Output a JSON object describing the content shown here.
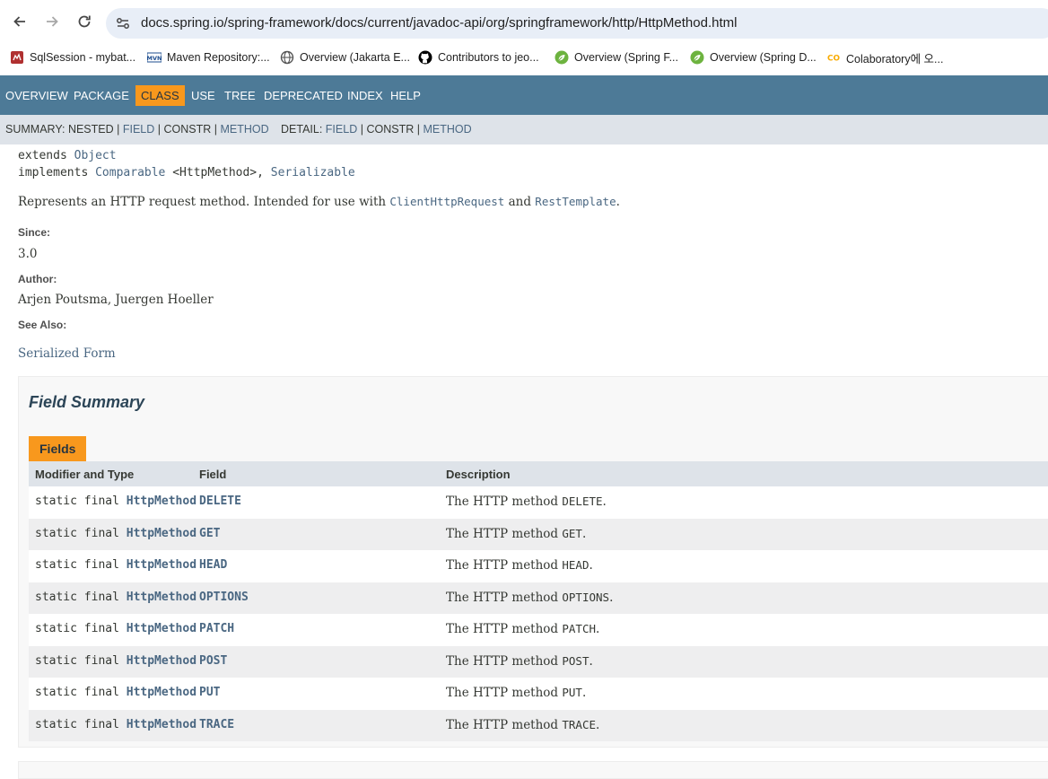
{
  "browser": {
    "url": "docs.spring.io/spring-framework/docs/current/javadoc-api/org/springframework/http/HttpMethod.html",
    "bookmarks": [
      {
        "label": "SqlSession - mybat...",
        "icon": "mybatis-icon",
        "color": "#b03030"
      },
      {
        "label": "Maven Repository:...",
        "icon": "mvn-icon",
        "color": "#1d4d8f",
        "text": "MVN"
      },
      {
        "label": "Overview (Jakarta E...",
        "icon": "globe-icon",
        "color": "#555555"
      },
      {
        "label": "Contributors to jeo...",
        "icon": "github-icon",
        "color": "#000000"
      },
      {
        "label": "Overview (Spring F...",
        "icon": "spring-leaf-icon",
        "color": "#6db33f"
      },
      {
        "label": "Overview (Spring D...",
        "icon": "spring-leaf-icon",
        "color": "#6db33f"
      },
      {
        "label": "Colaboratory에 오...",
        "icon": "colab-icon",
        "color": "#f9ab00",
        "text": "CO"
      }
    ]
  },
  "topnav": {
    "items": [
      "OVERVIEW",
      "PACKAGE",
      "CLASS",
      "USE",
      "TREE",
      "DEPRECATED",
      "INDEX",
      "HELP"
    ],
    "active": "CLASS",
    "active_color": "#f8981d",
    "bar_color": "#4d7a97"
  },
  "subnav": {
    "summary_label": "SUMMARY:",
    "summary_items": [
      "NESTED",
      "FIELD",
      "CONSTR",
      "METHOD"
    ],
    "detail_label": "DETAIL:",
    "detail_items": [
      "FIELD",
      "CONSTR",
      "METHOD"
    ],
    "sep": "|"
  },
  "classinfo": {
    "extends_kw": "extends",
    "extends_type": "Object",
    "implements_kw": "implements",
    "implements_type1": "Comparable",
    "implements_generic": "<HttpMethod>,",
    "implements_type2": "Serializable",
    "desc_pre": "Represents an HTTP request method. Intended for use with",
    "desc_link1": "ClientHttpRequest",
    "desc_mid": "and",
    "desc_link2": "RestTemplate",
    "desc_end": ".",
    "since_label": "Since:",
    "since_value": "3.0",
    "author_label": "Author:",
    "author_value": "Arjen Poutsma, Juergen Hoeller",
    "seealso_label": "See Also:",
    "seealso_value": "Serialized Form"
  },
  "field_summary": {
    "title": "Field Summary",
    "caption": "Fields",
    "headers": [
      "Modifier and Type",
      "Field",
      "Description"
    ],
    "rows": [
      {
        "mod": "static final",
        "type": "HttpMethod",
        "field": "DELETE",
        "desc_pre": "The HTTP method",
        "desc_code": "DELETE",
        "desc_end": "."
      },
      {
        "mod": "static final",
        "type": "HttpMethod",
        "field": "GET",
        "desc_pre": "The HTTP method",
        "desc_code": "GET",
        "desc_end": "."
      },
      {
        "mod": "static final",
        "type": "HttpMethod",
        "field": "HEAD",
        "desc_pre": "The HTTP method",
        "desc_code": "HEAD",
        "desc_end": "."
      },
      {
        "mod": "static final",
        "type": "HttpMethod",
        "field": "OPTIONS",
        "desc_pre": "The HTTP method",
        "desc_code": "OPTIONS",
        "desc_end": "."
      },
      {
        "mod": "static final",
        "type": "HttpMethod",
        "field": "PATCH",
        "desc_pre": "The HTTP method",
        "desc_code": "PATCH",
        "desc_end": "."
      },
      {
        "mod": "static final",
        "type": "HttpMethod",
        "field": "POST",
        "desc_pre": "The HTTP method",
        "desc_code": "POST",
        "desc_end": "."
      },
      {
        "mod": "static final",
        "type": "HttpMethod",
        "field": "PUT",
        "desc_pre": "The HTTP method",
        "desc_code": "PUT",
        "desc_end": "."
      },
      {
        "mod": "static final",
        "type": "HttpMethod",
        "field": "TRACE",
        "desc_pre": "The HTTP method",
        "desc_code": "TRACE",
        "desc_end": "."
      }
    ]
  }
}
